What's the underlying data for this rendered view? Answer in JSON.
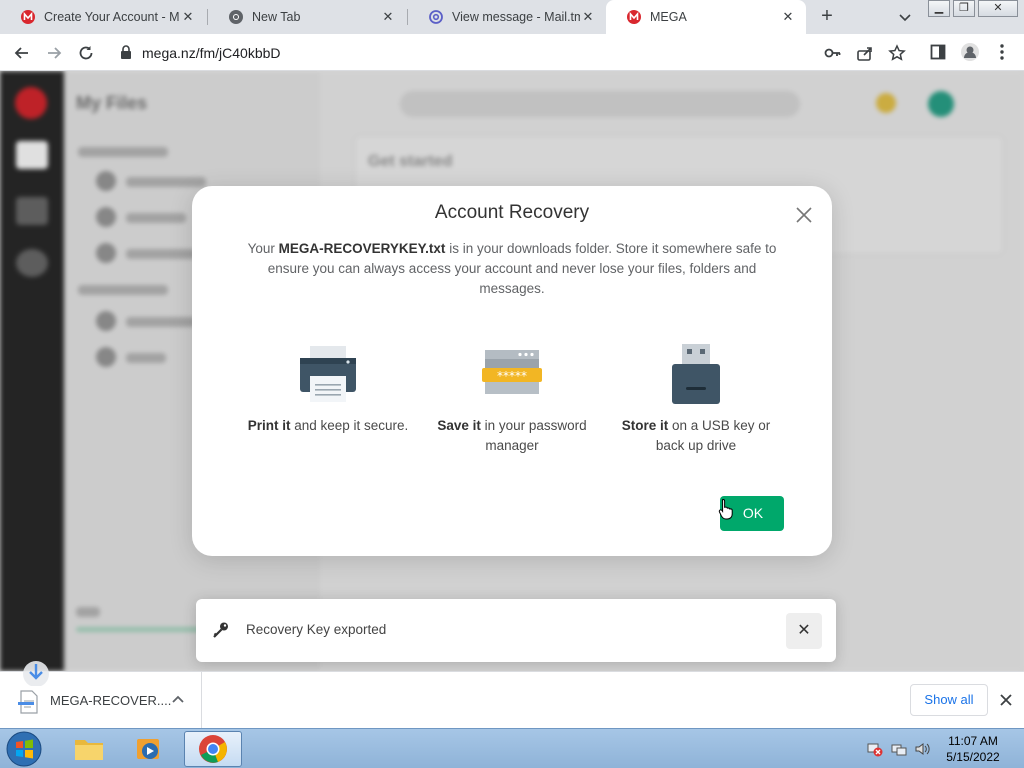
{
  "browser": {
    "tabs": [
      {
        "title": "Create Your Account - ME",
        "favicon": "mega-icon",
        "active": false
      },
      {
        "title": "New Tab",
        "favicon": "chrome-icon",
        "active": false
      },
      {
        "title": "View message - Mail.tm",
        "favicon": "at-icon",
        "active": false
      },
      {
        "title": "MEGA",
        "favicon": "mega-icon",
        "active": true
      }
    ],
    "url": "mega.nz/fm/jC40kbbD"
  },
  "background": {
    "sidebar_title": "My Files",
    "section_title": "Get started"
  },
  "dialog": {
    "title": "Account Recovery",
    "message_prefix": "Your ",
    "message_filename": "MEGA-RECOVERYKEY.txt",
    "message_suffix": " is in your downloads folder. Store it somewhere safe to ensure you can always access your account and never lose your files, folders and messages.",
    "options": [
      {
        "bold": "Print it",
        "text": " and keep it secure.",
        "icon": "printer-icon"
      },
      {
        "bold": "Save it",
        "text": " in your password manager",
        "icon": "password-manager-icon"
      },
      {
        "bold": "Store it",
        "text": " on a USB key or back up drive",
        "icon": "usb-drive-icon"
      }
    ],
    "ok_label": "OK"
  },
  "toast": {
    "message": "Recovery Key exported",
    "icon": "key-icon"
  },
  "downloads": {
    "file_name": "MEGA-RECOVER....",
    "show_all_label": "Show all"
  },
  "taskbar": {
    "time": "11:07 AM",
    "date": "5/15/2022"
  },
  "colors": {
    "mega_red": "#d9272e",
    "ok_green": "#00a86b",
    "link_blue": "#1a73e8"
  }
}
